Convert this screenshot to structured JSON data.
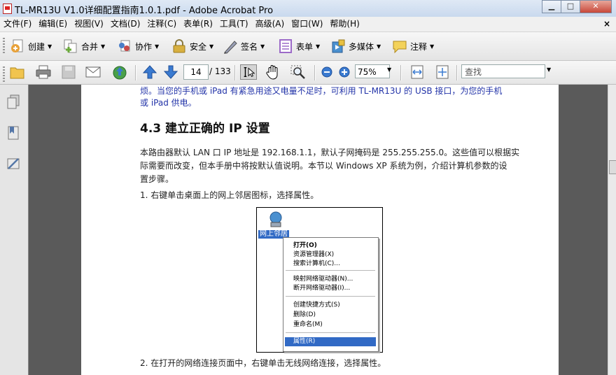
{
  "window": {
    "title": "TL-MR13U V1.0详细配置指南1.0.1.pdf - Adobe Acrobat Pro",
    "minimize": "▁",
    "maximize": "□",
    "close": "✕"
  },
  "menubar": {
    "items": [
      "文件(F)",
      "编辑(E)",
      "视图(V)",
      "文档(D)",
      "注释(C)",
      "表单(R)",
      "工具(T)",
      "高级(A)",
      "窗口(W)",
      "帮助(H)"
    ],
    "close_glyph": "×"
  },
  "tasks_toolbar": {
    "items": [
      {
        "label": "创建",
        "icon": "create-pdf-icon",
        "color": "#e8a23a"
      },
      {
        "label": "合并",
        "icon": "combine-icon",
        "color": "#6aaa3a"
      },
      {
        "label": "协作",
        "icon": "collaborate-icon",
        "color": "#4a7ec8"
      },
      {
        "label": "安全",
        "icon": "lock-icon",
        "color": "#d8b040"
      },
      {
        "label": "签名",
        "icon": "pen-icon",
        "color": "#8a8fa8"
      },
      {
        "label": "表单",
        "icon": "form-icon",
        "color": "#9c6ac8"
      },
      {
        "label": "多媒体",
        "icon": "multimedia-icon",
        "color": "#4a90d0"
      },
      {
        "label": "注释",
        "icon": "comment-icon",
        "color": "#e8c040"
      }
    ],
    "dropdown_arrow": "▼"
  },
  "nav_toolbar": {
    "current_page": "14",
    "page_count": "/ 133",
    "zoom": "75%",
    "search_placeholder": "查找",
    "dropdown_arrow": "▼"
  },
  "document": {
    "line_top_1": "烦。当您的手机或 iPad 有紧急用途又电量不足时，可利用 TL-MR13U 的 USB 接口，为您的手机",
    "line_top_2": "或 iPad 供电。",
    "heading": "4.3  建立正确的 IP 设置",
    "para_1": "本路由器默认 LAN 口 IP 地址是 192.168.1.1，默认子网掩码是 255.255.255.0。这些值可以根据实",
    "para_2": "际需要而改变，但本手册中将按默认值说明。本节以 Windows XP 系统为例，介绍计算机参数的设",
    "para_3": "置步骤。",
    "step_1": "1.    右键单击桌面上的网上邻居图标，选择属性。",
    "step_2": "2.    在打开的网络连接页面中，右键单击无线网络连接，选择属性。"
  },
  "figure": {
    "desktop_icon_label": "网上邻居",
    "menu": [
      "打开(O)",
      "资源管理器(X)",
      "搜索计算机(C)...",
      "映射网络驱动器(N)...",
      "断开网络驱动器(I)...",
      "创建快捷方式(S)",
      "删除(D)",
      "重命名(M)",
      "属性(R)"
    ]
  }
}
